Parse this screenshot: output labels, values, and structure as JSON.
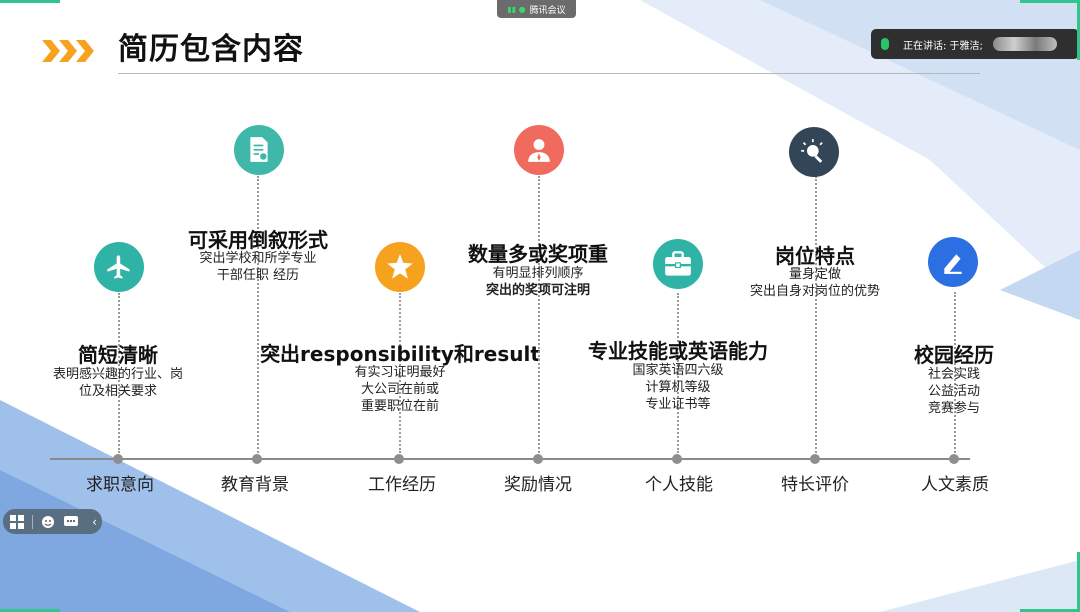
{
  "title": "简历包含内容",
  "meeting": {
    "app_name": "腾讯会议",
    "speaker_text": "正在讲话: 于雅洁;"
  },
  "colors": {
    "accent_orange": "#f6a21e",
    "teal": "#3bb7a8",
    "orange": "#f6a21e",
    "coral": "#ef6b5d",
    "navy": "#324657",
    "blue": "#2b6fe3",
    "bg_blue": "#8fb4e6"
  },
  "timeline": [
    {
      "category": "求职意向",
      "heading": "简短清晰",
      "lines": [
        "表明感兴趣的行业、岗",
        "位及相关要求"
      ],
      "icon": "airplane-icon",
      "color": "#2fb3a6"
    },
    {
      "category": "教育背景",
      "heading": "可采用倒叙形式",
      "lines": [
        "突出学校和所学专业",
        "干部任职 经历"
      ],
      "icon": "certificate-document-icon",
      "color": "#3fb8a9"
    },
    {
      "category": "工作经历",
      "heading": "突出responsibility和result",
      "lines": [
        "有实习证明最好",
        "大公司在前或",
        "重要职位在前"
      ],
      "icon": "star-badge-icon",
      "color": "#f6a21e"
    },
    {
      "category": "奖励情况",
      "heading": "数量多或奖项重",
      "lines": [
        "有明显排列顺序",
        "突出的奖项可注明"
      ],
      "icon": "person-award-icon",
      "color": "#ef6b5d"
    },
    {
      "category": "个人技能",
      "heading": "专业技能或英语能力",
      "lines": [
        "国家英语四六级",
        "计算机等级",
        "专业证书等"
      ],
      "icon": "toolbox-icon",
      "color": "#2fb3a6"
    },
    {
      "category": "特长评价",
      "heading": "岗位特点",
      "lines": [
        "量身定做",
        "突出自身对岗位的优势"
      ],
      "icon": "lightbulb-search-icon",
      "color": "#324657"
    },
    {
      "category": "人文素质",
      "heading": "校园经历",
      "lines": [
        "社会实践",
        "公益活动",
        "竞赛参与"
      ],
      "icon": "pen-icon",
      "color": "#2b6fe3"
    }
  ]
}
